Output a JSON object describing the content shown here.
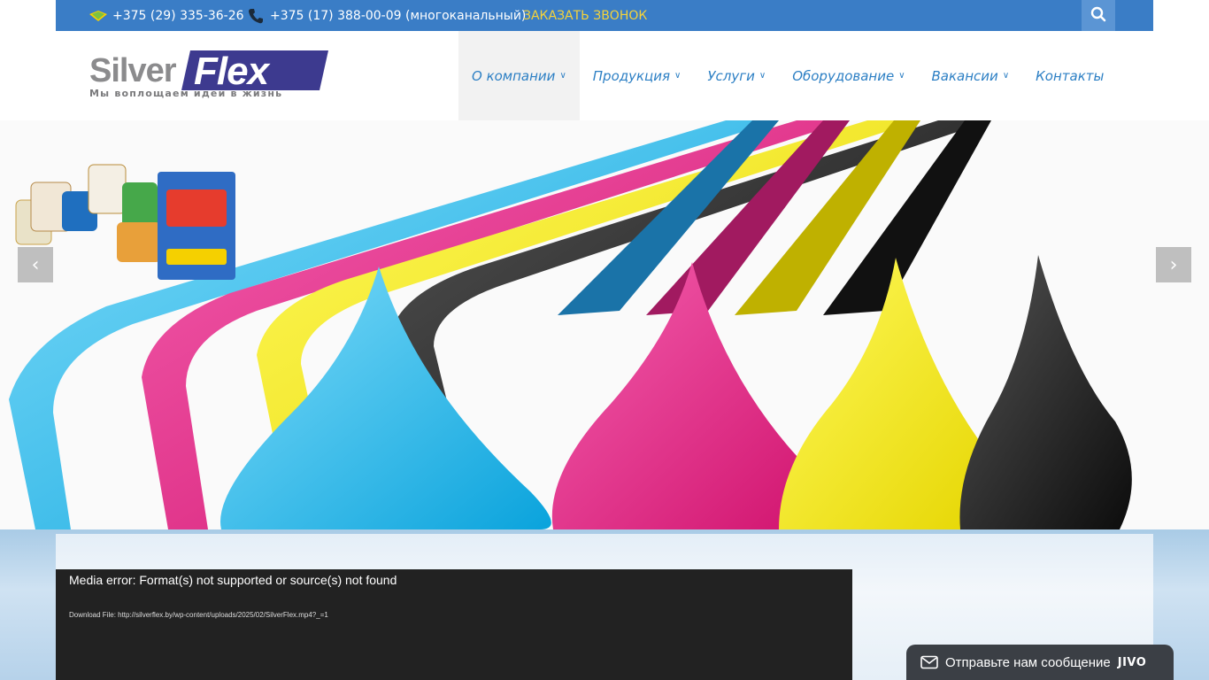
{
  "topbar": {
    "phone_velcom": "+375 (29) 335-36-26",
    "phone_city": "+375 (17) 388-00-09 (многоканальный)",
    "callback_label": "ЗАКАЗАТЬ ЗВОНОК",
    "icons": [
      "velcom-icon",
      "phone-icon",
      "search-icon"
    ]
  },
  "logo": {
    "silver": "Silver",
    "flex": "Flex",
    "slogan": "Мы воплощаем идеи в жизнь"
  },
  "nav": {
    "items": [
      {
        "label": "О компании",
        "has_submenu": true,
        "active": true
      },
      {
        "label": "Продукция",
        "has_submenu": true
      },
      {
        "label": "Услуги",
        "has_submenu": true
      },
      {
        "label": "Оборудование",
        "has_submenu": true
      },
      {
        "label": "Вакансии",
        "has_submenu": true
      },
      {
        "label": "Контакты",
        "has_submenu": false
      }
    ],
    "chevron": "∨"
  },
  "slider": {
    "prev": "‹",
    "next": "›",
    "colors": [
      "#29b6e8",
      "#e6257e",
      "#f7e600",
      "#222222"
    ]
  },
  "video": {
    "error": "Media error: Format(s) not supported or source(s) not found",
    "download": "Download File: http://silverflex.by/wp-content/uploads/2025/02/SilverFlex.mp4?_=1"
  },
  "chat": {
    "label": "Отправьте нам сообщение",
    "brand": "JIVO"
  },
  "colors": {
    "topbar": "#3a7dc6",
    "nav_text": "#2c7fc4",
    "callback": "#f5d33a",
    "logo_blue": "#3d3a8f"
  }
}
